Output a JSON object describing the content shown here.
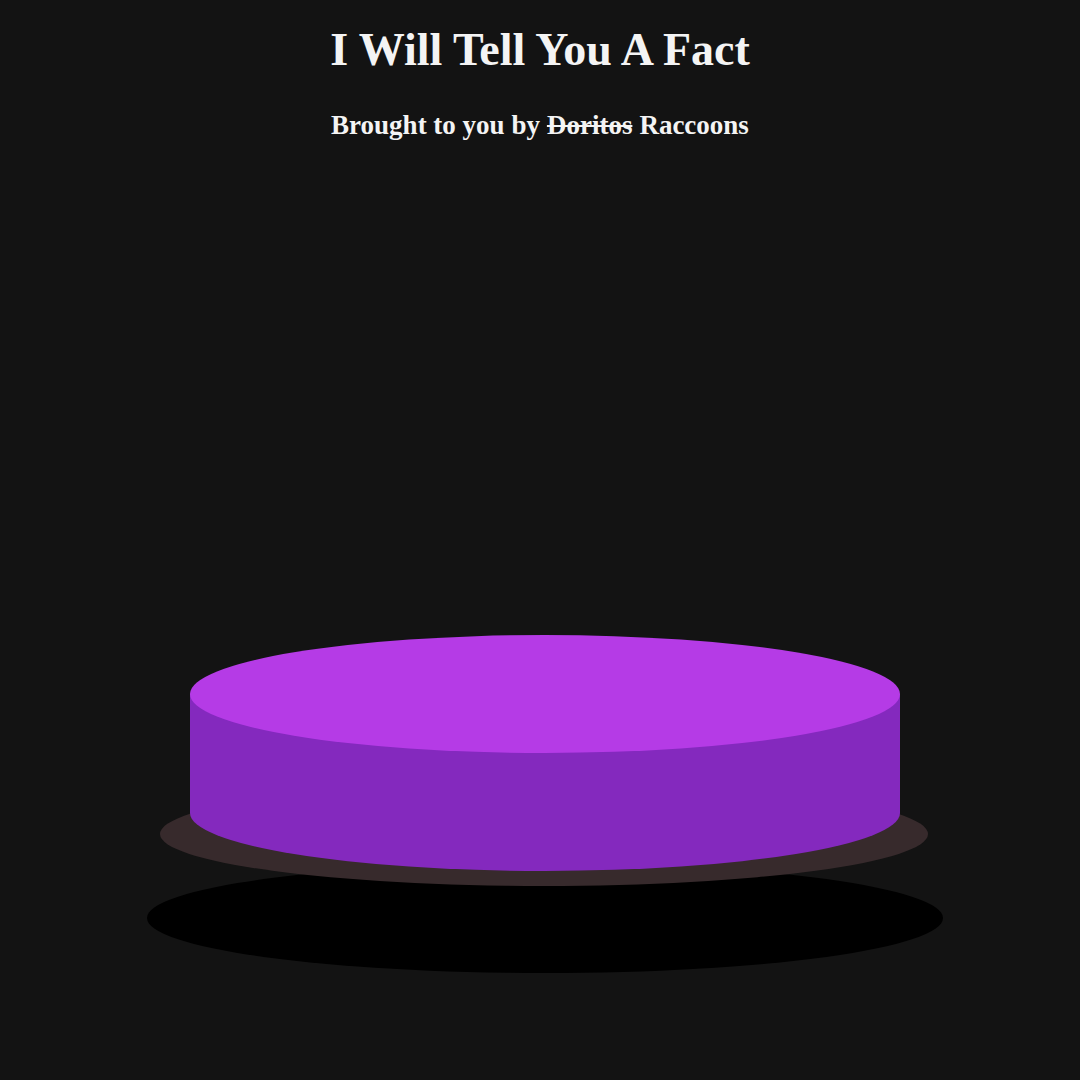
{
  "title": "I Will Tell You A Fact",
  "sponsor": {
    "prefix": "Brought to you by",
    "struck": "Doritos",
    "name": "Raccoons"
  }
}
